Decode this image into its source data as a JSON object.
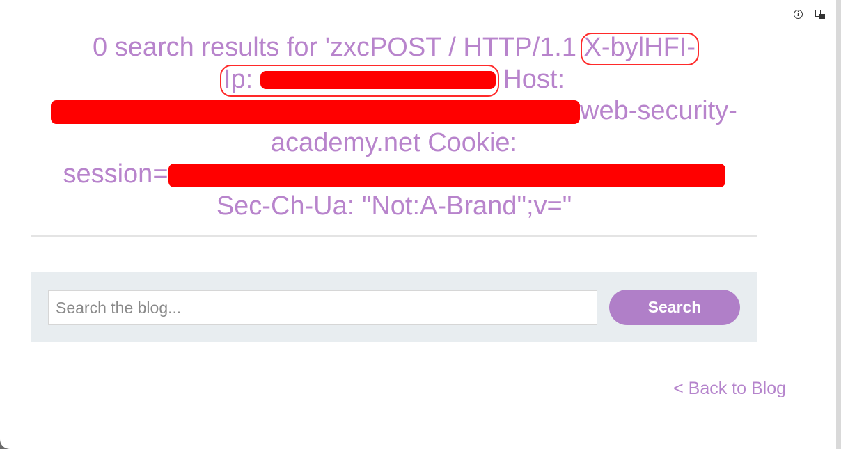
{
  "icons": {
    "info": "info-icon",
    "extension": "extension-icon"
  },
  "results": {
    "line1_main": "0 search results for 'zxcPOST / HTTP/1.1",
    "line1_circled": "X-bylHFI-",
    "line2_circled_prefix": "Ip:",
    "line2_after": "Host:",
    "line3_after": "web-security-",
    "line4": "academy.net Cookie:",
    "line5_prefix": "session=",
    "line6": "Sec-Ch-Ua: \"Not:A-Brand\";v=\""
  },
  "search": {
    "placeholder": "Search the blog...",
    "value": "",
    "button_label": "Search"
  },
  "back_link": "< Back to Blog",
  "colors": {
    "text_accent": "#b884cc",
    "button": "#b07fc8",
    "panel": "#e8edf0",
    "annotation": "#ff0000"
  }
}
